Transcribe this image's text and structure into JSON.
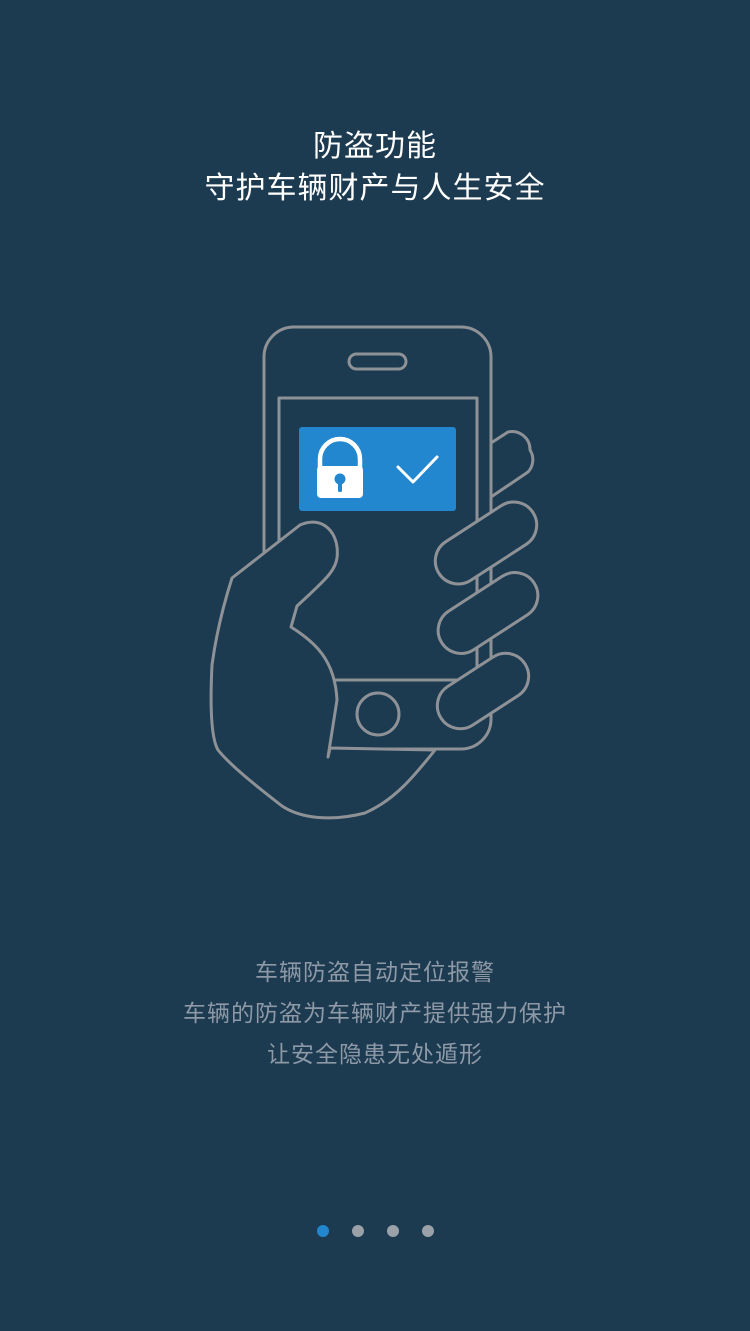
{
  "header": {
    "title": "防盗功能",
    "subtitle": "守护车辆财产与人生安全"
  },
  "illustration": {
    "icons": [
      "hand-holding-phone-icon",
      "padlock-icon",
      "checkmark-icon"
    ],
    "line_color": "#8e9296",
    "accent_color": "#2387cf"
  },
  "description": {
    "line1": "车辆防盗自动定位报警",
    "line2": "车辆的防盗为车辆财产提供强力保护",
    "line3": "让安全隐患无处遁形"
  },
  "pager": {
    "total": 4,
    "current_page": 1,
    "active_color": "#2387cf",
    "inactive_color": "#9aa1a8"
  },
  "colors": {
    "background": "#1c3a50",
    "title_text": "#ffffff",
    "body_text": "#8d99a6"
  }
}
